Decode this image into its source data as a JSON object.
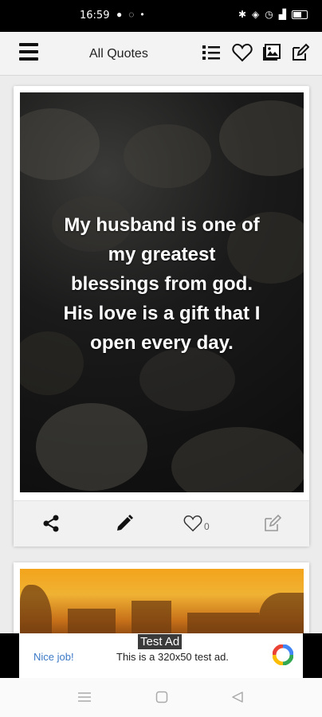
{
  "status_bar": {
    "time": "16:59",
    "left_icons": [
      "chat-icon",
      "location-icon",
      "dot-icon"
    ],
    "right_icons": [
      "bluetooth-icon",
      "vibrate-icon",
      "alarm-icon",
      "signal-icon",
      "battery-icon"
    ]
  },
  "appbar": {
    "title": "All Quotes",
    "icons": [
      "menu-icon",
      "list-icon",
      "heart-icon",
      "gallery-icon",
      "edit-icon"
    ]
  },
  "card": {
    "quote_lines": [
      "My husband is one of",
      "my greatest",
      "blessings from god.",
      "His love is a gift that I",
      "open every day."
    ],
    "actions": {
      "like_count": "0",
      "icons": [
        "share-icon",
        "pencil-icon",
        "heart-outline-icon",
        "edit-box-icon"
      ]
    }
  },
  "ad": {
    "tag": "Test Ad",
    "nice": "Nice job!",
    "message": "This is a 320x50 test ad."
  },
  "navbar": {
    "icons": [
      "recents-icon",
      "home-icon",
      "back-icon"
    ]
  }
}
